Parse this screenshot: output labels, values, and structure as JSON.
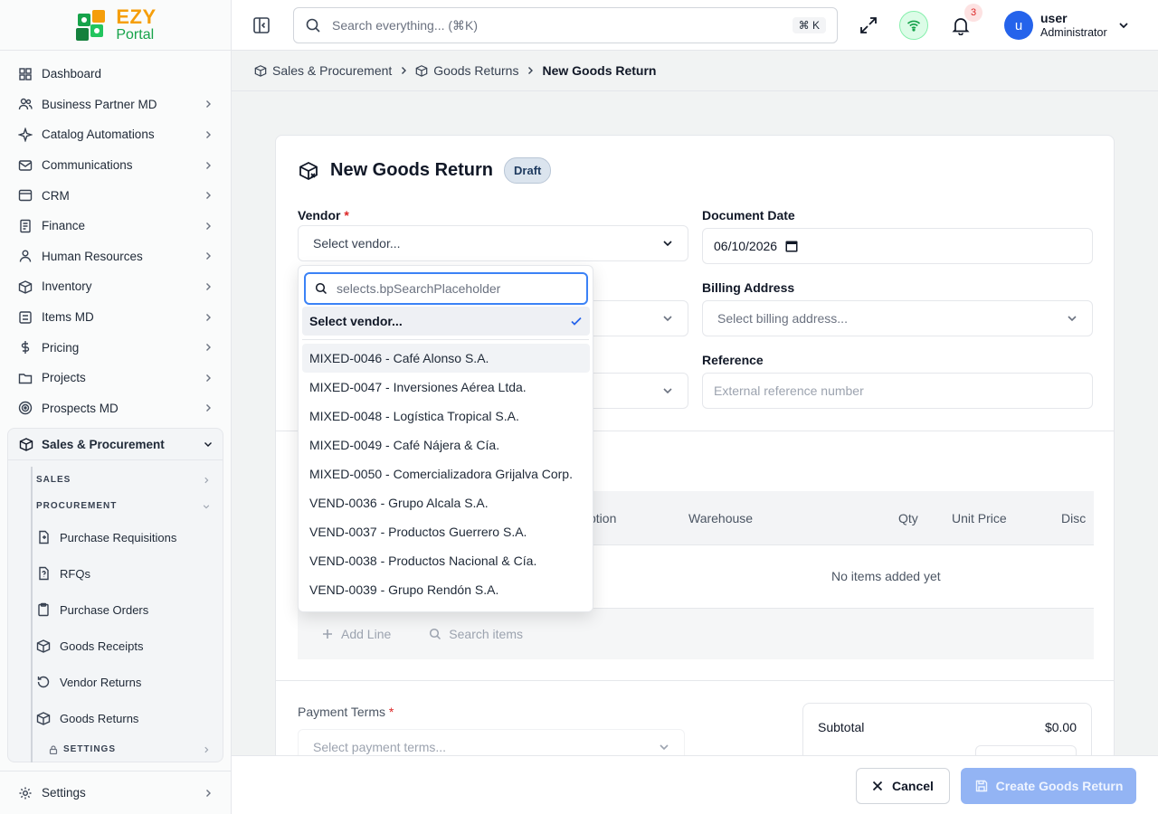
{
  "brand": {
    "logo_top": "EZY",
    "logo_bottom": "Portal"
  },
  "sidebar": {
    "items": [
      {
        "label": "Dashboard",
        "icon": "dashboard-icon",
        "has_children": false
      },
      {
        "label": "Business Partner MD",
        "icon": "users-icon",
        "has_children": true
      },
      {
        "label": "Catalog Automations",
        "icon": "spark-icon",
        "has_children": true
      },
      {
        "label": "Communications",
        "icon": "mail-icon",
        "has_children": true
      },
      {
        "label": "CRM",
        "icon": "crm-icon",
        "has_children": true
      },
      {
        "label": "Finance",
        "icon": "finance-icon",
        "has_children": true
      },
      {
        "label": "Human Resources",
        "icon": "people-icon",
        "has_children": true
      },
      {
        "label": "Inventory",
        "icon": "inventory-icon",
        "has_children": true
      },
      {
        "label": "Items MD",
        "icon": "items-icon",
        "has_children": true
      },
      {
        "label": "Pricing",
        "icon": "dollar-icon",
        "has_children": true
      },
      {
        "label": "Projects",
        "icon": "projects-icon",
        "has_children": true
      },
      {
        "label": "Prospects MD",
        "icon": "target-icon",
        "has_children": true
      }
    ],
    "group": {
      "label": "Sales & Procurement",
      "sections": {
        "sales": "SALES",
        "procurement": "PROCUREMENT",
        "settings": "SETTINGS"
      },
      "sub_items": [
        {
          "label": "Purchase Requisitions",
          "icon": "requisition-icon"
        },
        {
          "label": "RFQs",
          "icon": "rfq-icon"
        },
        {
          "label": "Purchase Orders",
          "icon": "clipboard-icon"
        },
        {
          "label": "Goods Receipts",
          "icon": "package-icon"
        },
        {
          "label": "Vendor Returns",
          "icon": "return-icon"
        },
        {
          "label": "Goods Returns",
          "icon": "package-x-icon"
        }
      ]
    },
    "settings": "Settings"
  },
  "topbar": {
    "search_placeholder": "Search everything... (⌘K)",
    "shortcut": "⌘ K",
    "notifications": "3",
    "avatar_letter": "u",
    "user_name": "user",
    "user_role": "Administrator"
  },
  "breadcrumb": [
    "Sales & Procurement",
    "Goods Returns",
    "New Goods Return"
  ],
  "form": {
    "title": "New Goods Return",
    "status": "Draft",
    "vendor_label": "Vendor",
    "vendor_placeholder": "Select vendor...",
    "document_date_label": "Document Date",
    "document_date": "06/10/2026",
    "billing_label": "Billing Address",
    "billing_placeholder": "Select billing address...",
    "reference_label": "Reference",
    "reference_placeholder": "External reference number",
    "payment_terms_label": "Payment Terms",
    "payment_terms_placeholder": "Select payment terms..."
  },
  "lines": {
    "columns": [
      "ption",
      "Warehouse",
      "Qty",
      "Unit Price",
      "Disc"
    ],
    "empty_text": "No items added yet",
    "add_line": "Add Line",
    "search_items": "Search items"
  },
  "totals": {
    "subtotal_label": "Subtotal",
    "subtotal_value": "$0.00"
  },
  "dropdown": {
    "search_placeholder": "selects.bpSearchPlaceholder",
    "selected": "Select vendor...",
    "options": [
      "MIXED-0046 - Café Alonso S.A.",
      "MIXED-0047 - Inversiones Aérea Ltda.",
      "MIXED-0048 - Logística Tropical S.A.",
      "MIXED-0049 - Café Nájera & Cía.",
      "MIXED-0050 - Comercializadora Grijalva Corp.",
      "VEND-0036 - Grupo Alcala S.A.",
      "VEND-0037 - Productos Guerrero S.A.",
      "VEND-0038 - Productos Nacional & Cía.",
      "VEND-0039 - Grupo Rendón S.A."
    ]
  },
  "actions": {
    "cancel": "Cancel",
    "create": "Create Goods Return"
  }
}
